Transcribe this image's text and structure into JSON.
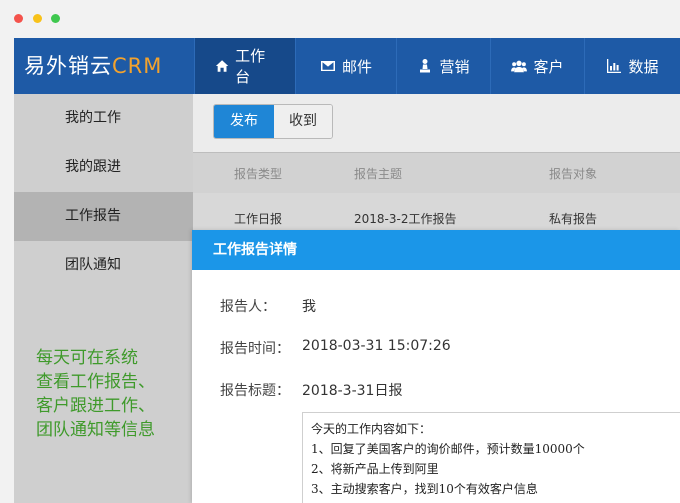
{
  "window": {
    "controls": [
      "close",
      "minimize",
      "maximize"
    ]
  },
  "brand": {
    "name_cn": "易外销云",
    "name_en": "CRM",
    "accent_color": "#f3a22d"
  },
  "nav": [
    {
      "label": "工作台",
      "icon": "home-icon",
      "active": true
    },
    {
      "label": "邮件",
      "icon": "mail-icon"
    },
    {
      "label": "营销",
      "icon": "marketing-icon"
    },
    {
      "label": "客户",
      "icon": "users-icon"
    },
    {
      "label": "数据",
      "icon": "chart-icon"
    }
  ],
  "sidebar": {
    "items": [
      {
        "label": "我的工作"
      },
      {
        "label": "我的跟进"
      },
      {
        "label": "工作报告",
        "active": true
      },
      {
        "label": "团队通知"
      }
    ],
    "promo_lines": [
      "每天可在系统",
      "查看工作报告、",
      "客户跟进工作、",
      "团队通知等信息"
    ]
  },
  "segment": {
    "publish": "发布",
    "received": "收到",
    "selected": "发布"
  },
  "table": {
    "headers": [
      "报告类型",
      "报告主题",
      "报告对象"
    ],
    "rows": [
      [
        "工作日报",
        "2018-3-2工作报告",
        "私有报告"
      ]
    ]
  },
  "modal": {
    "title": "工作报告详情",
    "reporter_label": "报告人：",
    "reporter_value": "我",
    "time_label": "报告时间：",
    "time_value": "2018-03-31 15:07:26",
    "subject_label": "报告标题：",
    "subject_value": "2018-3-31日报",
    "content_lines": [
      "今天的工作内容如下：",
      "1、回复了美国客户的询价邮件，预计数量10000个",
      "2、将新产品上传到阿里",
      "3、主动搜索客户，找到10个有效客户信息"
    ]
  },
  "colors": {
    "topbar": "#1e5aa6",
    "modal_header": "#1b96e8",
    "promo_text": "#3f9a2b"
  }
}
